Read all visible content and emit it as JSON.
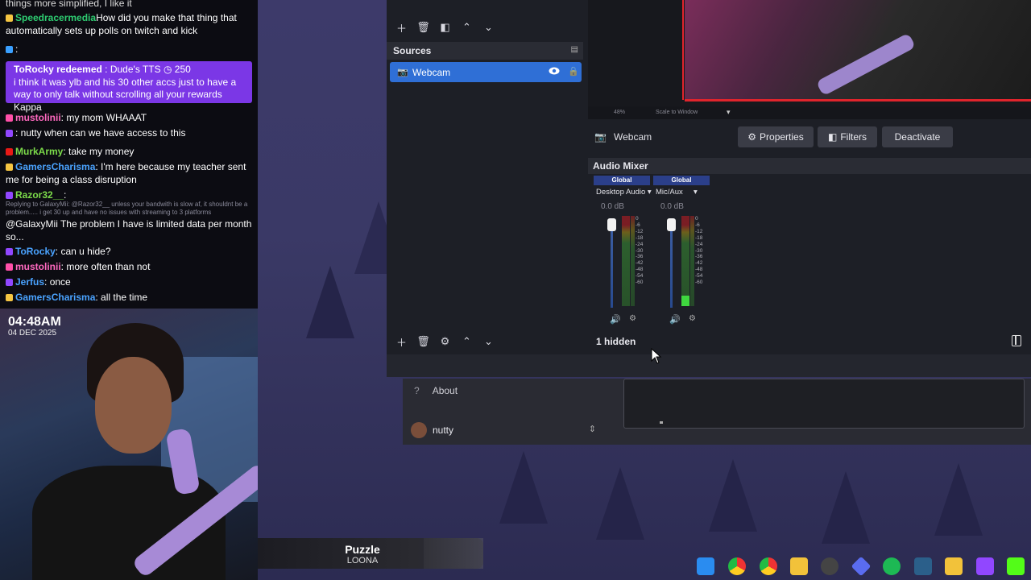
{
  "chat": {
    "top_line": "things more simplified, I like it",
    "messages": [
      {
        "badge": "b-gold",
        "user": "Speedracermedia",
        "user_color": "#2ecc71",
        "text": "How did you make that thing that automatically sets up polls on twitch and kick"
      },
      {
        "badge": "b-blue",
        "user": "",
        "user_color": "#2f3fd6",
        "text": ":"
      }
    ],
    "redeem": {
      "title": "ToRocky redeemed",
      "reward": ": Dude's TTS",
      "cost": "250",
      "text": "i think it was ylb and his 30 other accs just to have a way to only talk without scrolling all your rewards Kappa"
    },
    "messages2": [
      {
        "badge": "b-pink",
        "user": "mustolinii",
        "user_color": "#ff69c0",
        "text": ": my mom WHAAAT"
      },
      {
        "badge": "b-purple",
        "user": "",
        "user_color": "#2f3fd6",
        "text": ": nutty when can we have access to this"
      },
      {
        "badge": "b-red",
        "user": "MurkArmy",
        "user_color": "#7cdb4a",
        "text": ": take my money"
      },
      {
        "badge": "b-gold",
        "user": "GamersCharisma",
        "user_color": "#4aa3ff",
        "text": ": I'm here because my teacher sent me for being a class disruption"
      },
      {
        "badge": "b-purple",
        "user": "Razor32__",
        "user_color": "#7cdb4a",
        "text": ":"
      }
    ],
    "reply_note": "Replying to GalaxyMii: @Razor32__ unless your bandwith is slow af, it shouldnt be a problem..... i get 30 up and have no issues with streaming to 3 platforms",
    "plain_message": "@GalaxyMii The problem I have is limited data per month so...",
    "messages3": [
      {
        "badge": "b-purple",
        "user": "ToRocky",
        "user_color": "#4aa3ff",
        "text": ": can u hide?"
      },
      {
        "badge": "b-pink",
        "user": "mustolinii",
        "user_color": "#ff69c0",
        "text": ": more often than not"
      },
      {
        "badge": "b-purple",
        "user": "Jerfus",
        "user_color": "#4aa3ff",
        "text": ": once"
      },
      {
        "badge": "b-gold",
        "user": "GamersCharisma",
        "user_color": "#4aa3ff",
        "text": ": all the time"
      }
    ]
  },
  "webcam": {
    "time": "04:48AM",
    "date": "04 DEC 2025"
  },
  "sources": {
    "title": "Sources",
    "items": [
      {
        "name": "Webcam",
        "visible": true,
        "locked": false
      }
    ]
  },
  "preview": {
    "zoom": "48%",
    "scale_mode": "Scale to Window"
  },
  "context_bar": {
    "source_name": "Webcam",
    "properties": "Properties",
    "filters": "Filters",
    "deactivate": "Deactivate"
  },
  "mixer": {
    "title": "Audio Mixer",
    "channels": [
      {
        "scope": "Global",
        "device": "Desktop Audio",
        "db": "0.0 dB",
        "level": 0.0
      },
      {
        "scope": "Global",
        "device": "Mic/Aux",
        "db": "0.0 dB",
        "level": 0.12
      }
    ],
    "ticks": [
      "0",
      "-6",
      "-12",
      "-18",
      "-24",
      "-30",
      "-36",
      "-42",
      "-48",
      "-54",
      "-60"
    ],
    "hidden_label": "1 hidden"
  },
  "settings": {
    "about": "About",
    "user": "nutty"
  },
  "now_playing": {
    "title": "Puzzle",
    "artist": "LOONA"
  },
  "colors": {
    "accent": "#2f6fd6",
    "panel": "#1d1f26",
    "redeem": "#7b37e6"
  }
}
